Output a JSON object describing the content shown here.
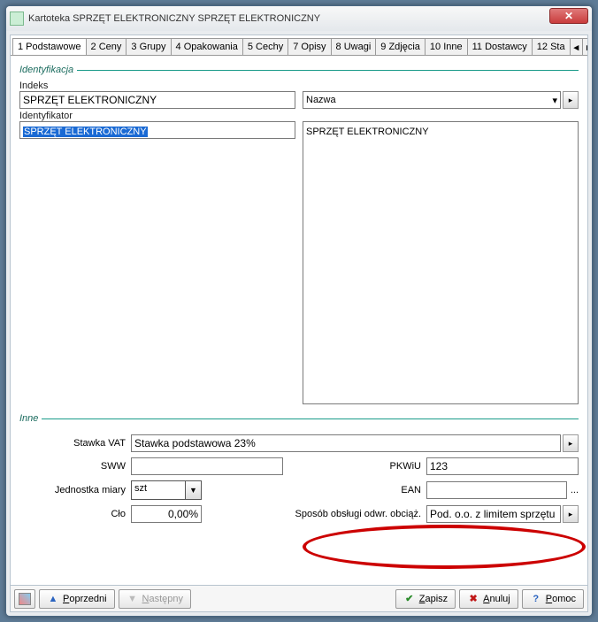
{
  "title": "Kartoteka  SPRZĘT ELEKTRONICZNY  SPRZĘT ELEKTRONICZNY",
  "tabs": {
    "t1": "1 Podstawowe",
    "t2": "2 Ceny",
    "t3": "3 Grupy",
    "t4": "4 Opakowania",
    "t5": "5 Cechy",
    "t7": "7 Opisy",
    "t8": "8 Uwagi",
    "t9": "9 Zdjęcia",
    "t10": "10 Inne",
    "t11": "11 Dostawcy",
    "t12": "12 Sta"
  },
  "ident": {
    "section": "Identyfikacja",
    "indeks_label": "Indeks",
    "indeks_value": "SPRZĘT ELEKTRONICZNY",
    "identyfikator_label": "Identyfikator",
    "identyfikator_value": "SPRZĘT ELEKTRONICZNY",
    "nazwa_combo": "Nazwa",
    "nazwa_value": "SPRZĘT ELEKTRONICZNY"
  },
  "inne": {
    "section": "Inne",
    "stawka_vat_label": "Stawka VAT",
    "stawka_vat_value": "Stawka podstawowa 23%",
    "sww_label": "SWW",
    "sww_value": "",
    "pkwiu_label": "PKWiU",
    "pkwiu_value": "123",
    "jednostka_label": "Jednostka miary",
    "jednostka_value": "szt",
    "ean_label": "EAN",
    "ean_value": "",
    "clo_label": "Cło",
    "clo_value": "0,00%",
    "sposob_label": "Sposób obsługi odwr. obciąż.",
    "sposob_value": "Pod. o.o. z limitem sprzętu",
    "ellipsis": "..."
  },
  "footer": {
    "poprzedni": "Poprzedni",
    "nastepny": "Następny",
    "zapisz": "Zapisz",
    "anuluj": "Anuluj",
    "pomoc": "Pomoc"
  }
}
